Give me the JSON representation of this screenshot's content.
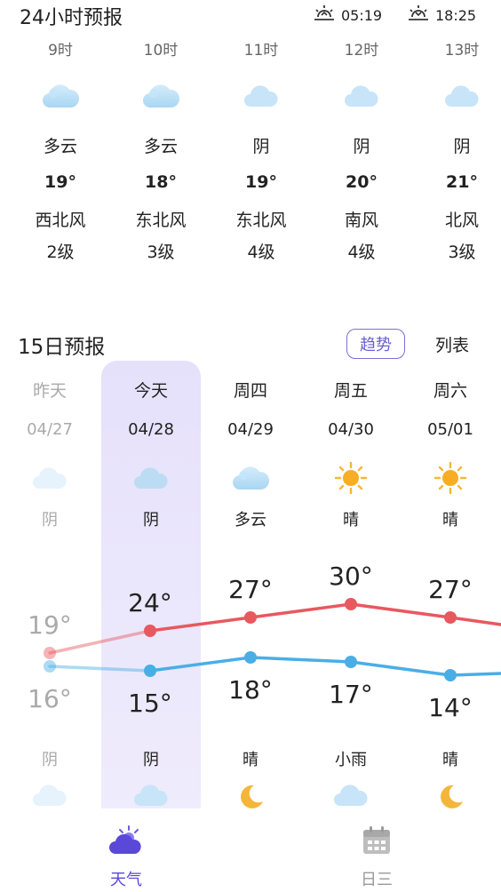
{
  "hourly": {
    "title": "24小时预报",
    "sunrise": "05:19",
    "sunset": "18:25",
    "items": [
      {
        "time": "9时",
        "icon": "partly-cloudy-icon",
        "cond": "多云",
        "temp": "19°",
        "wind": "西北风",
        "level": "2级"
      },
      {
        "time": "10时",
        "icon": "partly-cloudy-icon",
        "cond": "多云",
        "temp": "18°",
        "wind": "东北风",
        "level": "3级"
      },
      {
        "time": "11时",
        "icon": "overcast-cloud-icon",
        "cond": "阴",
        "temp": "19°",
        "wind": "东北风",
        "level": "4级"
      },
      {
        "time": "12时",
        "icon": "overcast-cloud-icon",
        "cond": "阴",
        "temp": "20°",
        "wind": "南风",
        "level": "4级"
      },
      {
        "time": "13时",
        "icon": "overcast-cloud-icon",
        "cond": "阴",
        "temp": "21°",
        "wind": "北风",
        "level": "3级"
      }
    ]
  },
  "daily": {
    "title": "15日预报",
    "trend_label": "趋势",
    "list_label": "列表",
    "items": [
      {
        "name": "昨天",
        "date": "04/27",
        "day_icon": "overcast-cloud-icon",
        "day_cond": "阴",
        "high_label": "19°",
        "low_label": "16°",
        "night_cond": "阴",
        "night_icon": "cloud-icon",
        "past": true
      },
      {
        "name": "今天",
        "date": "04/28",
        "day_icon": "overcast-cloud-icon",
        "day_cond": "阴",
        "high_label": "24°",
        "low_label": "15°",
        "night_cond": "阴",
        "night_icon": "cloud-icon",
        "past": false
      },
      {
        "name": "周四",
        "date": "04/29",
        "day_icon": "partly-cloudy-icon",
        "day_cond": "多云",
        "high_label": "27°",
        "low_label": "18°",
        "night_cond": "晴",
        "night_icon": "moon-icon",
        "past": false
      },
      {
        "name": "周五",
        "date": "04/30",
        "day_icon": "sun-icon",
        "day_cond": "晴",
        "high_label": "30°",
        "low_label": "17°",
        "night_cond": "小雨",
        "night_icon": "cloud-icon",
        "past": false
      },
      {
        "name": "周六",
        "date": "05/01",
        "day_icon": "sun-icon",
        "day_cond": "晴",
        "high_label": "27°",
        "low_label": "14°",
        "night_cond": "晴",
        "night_icon": "moon-icon",
        "past": false
      }
    ]
  },
  "chart_data": {
    "type": "line",
    "categories": [
      "04/27",
      "04/28",
      "04/29",
      "04/30",
      "05/01"
    ],
    "series": [
      {
        "values": [
          19,
          24,
          27,
          30,
          27
        ],
        "color": "#e8585f"
      },
      {
        "values": [
          16,
          15,
          18,
          17,
          14
        ],
        "color": "#4aaee6"
      }
    ]
  },
  "nav": {
    "weather_label": "天气",
    "calendar_label": "日三"
  },
  "colors": {
    "accent": "#5a48d8",
    "high": "#e8585f",
    "low": "#4aaee6",
    "highlight": "#e8e4fb"
  }
}
